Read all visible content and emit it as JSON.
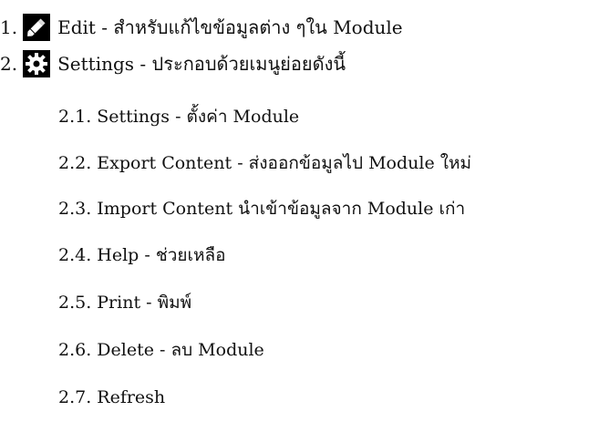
{
  "items": [
    {
      "number": "1.",
      "icon": "pencil-icon",
      "text": "Edit - สำหรับแก้ไขข้อมูลต่าง ๆใน Module"
    },
    {
      "number": "2.",
      "icon": "gear-icon",
      "text": "Settings - ประกอบด้วยเมนูย่อยดังนี้",
      "subitems": [
        {
          "number": "2.1.",
          "text": "Settings - ตั้งค่า Module"
        },
        {
          "number": "2.2.",
          "text": "Export Content - ส่งออกข้อมูลไป Module ใหม่"
        },
        {
          "number": "2.3.",
          "text": "Import Content นำเข้าข้อมูลจาก Module เก่า"
        },
        {
          "number": "2.4.",
          "text": "Help - ช่วยเหลือ"
        },
        {
          "number": "2.5.",
          "text": "Print - พิมพ์"
        },
        {
          "number": "2.6.",
          "text": "Delete - ลบ Module"
        },
        {
          "number": "2.7.",
          "text": "Refresh"
        }
      ]
    }
  ]
}
